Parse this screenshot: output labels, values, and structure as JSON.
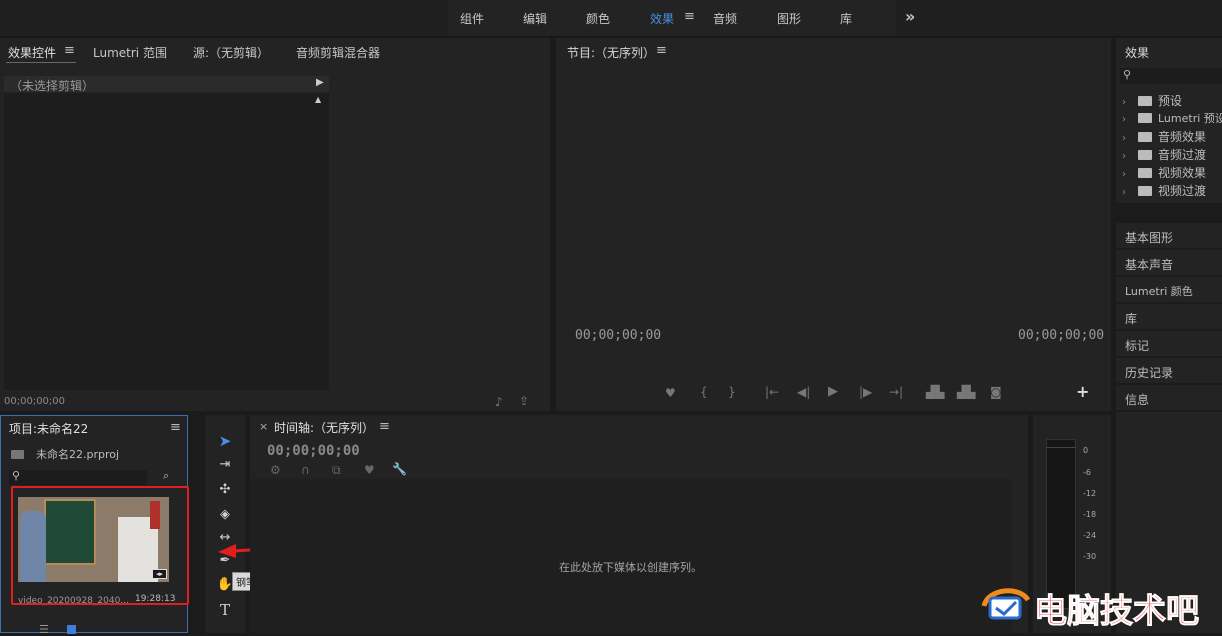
{
  "workspace_tabs": [
    "组件",
    "编辑",
    "颜色",
    "效果",
    "音频",
    "图形",
    "库"
  ],
  "workspace_active": "效果",
  "workspace_more": "»",
  "effect_controls": {
    "tabs": [
      "效果控件",
      "Lumetri 范围",
      "源:（无剪辑）",
      "音频剪辑混合器"
    ],
    "no_clip": "（未选择剪辑）",
    "timecode": "00;00;00;00"
  },
  "program": {
    "title": "节目:（无序列）",
    "tc_left": "00;00;00;00",
    "tc_right": "00;00;00;00"
  },
  "effects_panel": {
    "title": "效果",
    "search_icon": "search-icon",
    "items": [
      "预设",
      "Lumetri 预设",
      "音频效果",
      "音频过渡",
      "视频效果",
      "视频过渡"
    ]
  },
  "right_panels": [
    "基本图形",
    "基本声音",
    "Lumetri 颜色",
    "库",
    "标记",
    "历史记录",
    "信息"
  ],
  "project": {
    "title": "项目:未命名22",
    "file": "未命名22.prproj",
    "clip_name": "video_20200928_2040...",
    "clip_duration": "19:28:13"
  },
  "tools": {
    "tooltip": "钢笔工具 (P)"
  },
  "timeline": {
    "title": "时间轴:（无序列）",
    "close": "×",
    "timecode": "00;00;00;00",
    "drop_hint": "在此处放下媒体以创建序列。"
  },
  "meter": {
    "labels": [
      "0",
      "-6",
      "-12",
      "-18",
      "-24",
      "-30"
    ]
  },
  "watermark": {
    "text": "电脑技术吧"
  },
  "colors": {
    "accent": "#4b8fe2",
    "highlight_box": "#e02020",
    "watermark": "#e8332a"
  }
}
